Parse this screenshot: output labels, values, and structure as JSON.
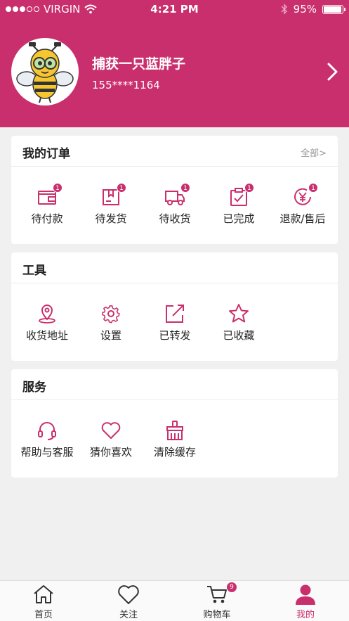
{
  "status": {
    "carrier": "VIRGIN",
    "time": "4:21 PM",
    "battery": "95%",
    "battery_level": 0.95
  },
  "profile": {
    "name": "捕获一只蓝胖子",
    "phone": "155****1164"
  },
  "orders": {
    "title": "我的订单",
    "more": "全部>",
    "items": [
      {
        "label": "待付款",
        "icon": "wallet-icon",
        "badge": "1"
      },
      {
        "label": "待发货",
        "icon": "package-icon",
        "badge": "1"
      },
      {
        "label": "待收货",
        "icon": "truck-icon",
        "badge": "1"
      },
      {
        "label": "已完成",
        "icon": "clipboard-check-icon",
        "badge": "1"
      },
      {
        "label": "退款/售后",
        "icon": "yuan-refund-icon",
        "badge": "1"
      }
    ]
  },
  "tools": {
    "title": "工具",
    "items": [
      {
        "label": "收货地址",
        "icon": "location-pin-icon"
      },
      {
        "label": "设置",
        "icon": "gear-icon"
      },
      {
        "label": "已转发",
        "icon": "share-icon"
      },
      {
        "label": "已收藏",
        "icon": "star-icon"
      }
    ]
  },
  "services": {
    "title": "服务",
    "items": [
      {
        "label": "帮助与客服",
        "icon": "headset-icon"
      },
      {
        "label": "猜你喜欢",
        "icon": "heart-icon"
      },
      {
        "label": "清除缓存",
        "icon": "broom-icon"
      }
    ]
  },
  "tabbar": {
    "items": [
      {
        "label": "首页",
        "icon": "home-icon"
      },
      {
        "label": "关注",
        "icon": "heart-icon"
      },
      {
        "label": "购物车",
        "icon": "cart-icon",
        "badge": "9"
      },
      {
        "label": "我的",
        "icon": "person-icon",
        "active": true
      }
    ]
  },
  "colors": {
    "accent": "#c92f6d",
    "background": "#f0f0f0"
  }
}
